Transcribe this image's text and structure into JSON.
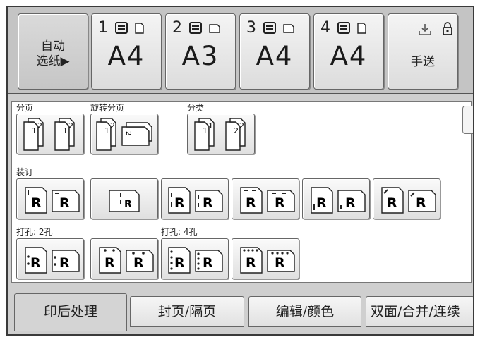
{
  "trays": {
    "auto_select": {
      "label_line1": "自动",
      "label_line2": "选纸▶"
    },
    "items": [
      {
        "number": "1",
        "size": "A4",
        "orientation_icon": "portrait-paper-icon"
      },
      {
        "number": "2",
        "size": "A3",
        "orientation_icon": "landscape-paper-icon"
      },
      {
        "number": "3",
        "size": "A4",
        "orientation_icon": "landscape-paper-icon"
      },
      {
        "number": "4",
        "size": "A4",
        "orientation_icon": "portrait-paper-icon"
      }
    ],
    "manual_feed": {
      "label": "手送"
    }
  },
  "finishing": {
    "sort_label": "分页",
    "rotate_sort_label": "旋转分页",
    "stack_label": "分类",
    "staple_label": "装订",
    "punch2_label": "打孔: 2孔",
    "punch4_label": "打孔: 4孔",
    "glyph": "R",
    "page_number_1": "1",
    "page_number_2": "2"
  },
  "tabs": [
    {
      "label": "印后处理",
      "active": true
    },
    {
      "label": "封页/隔页",
      "active": false
    },
    {
      "label": "编辑/颜色",
      "active": false
    },
    {
      "label": "双面/合并/连续",
      "active": false
    }
  ]
}
